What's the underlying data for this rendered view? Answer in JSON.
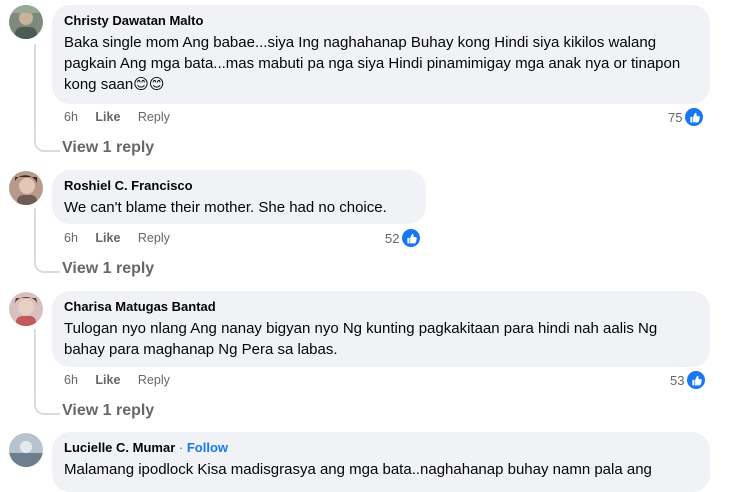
{
  "comments": [
    {
      "author": "Christy Dawatan Malto",
      "follow": "",
      "text": "Baka single mom Ang babae...siya Ing naghahanap Buhay kong Hindi siya kikilos walang pagkain Ang mga bata...mas mabuti pa nga siya Hindi pinamimigay mga anak nya or tinapon kong saan😊😊",
      "time": "6h",
      "like_label": "Like",
      "reply_label": "Reply",
      "reaction_count": "75",
      "view_replies": "View 1 reply"
    },
    {
      "author": "Roshiel C. Francisco",
      "follow": "",
      "text": "We can't blame their mother. She had no choice.",
      "time": "6h",
      "like_label": "Like",
      "reply_label": "Reply",
      "reaction_count": "52",
      "view_replies": "View 1 reply"
    },
    {
      "author": "Charisa Matugas Bantad",
      "follow": "",
      "text": "Tulogan nyo nlang Ang nanay bigyan nyo Ng kunting pagkakitaan para hindi nah aalis Ng bahay para maghanap Ng Pera sa labas.",
      "time": "6h",
      "like_label": "Like",
      "reply_label": "Reply",
      "reaction_count": "53",
      "view_replies": "View 1 reply"
    },
    {
      "author": "Lucielle C. Mumar",
      "follow": "Follow",
      "separator": "·",
      "text": "Malamang ipodlock Kisa madisgrasya ang mga bata..naghahanap buhay namn pala ang"
    }
  ],
  "colors": {
    "bubble": "#f0f2f5",
    "meta": "#65676b",
    "accent": "#1877f2"
  }
}
